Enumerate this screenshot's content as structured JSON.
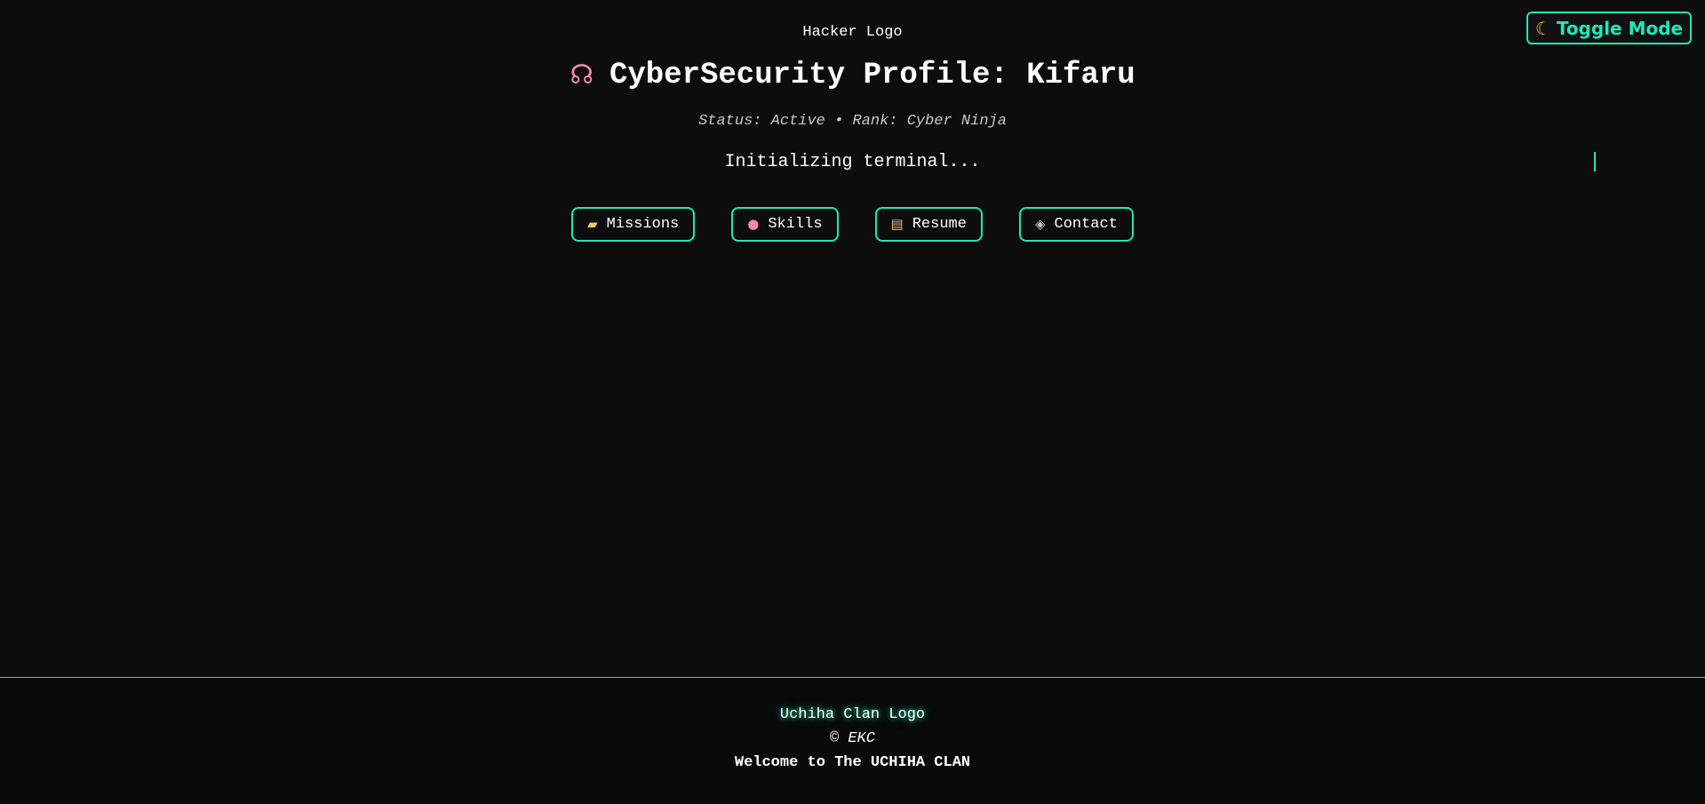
{
  "toggle": {
    "icon": "moon-icon",
    "label": "Toggle Mode"
  },
  "header": {
    "logo_alt": "Hacker Logo",
    "title_icon": "brain-icon",
    "title": "CyberSecurity Profile: Kifaru",
    "status": "Status: Active • Rank: Cyber Ninja",
    "terminal": "Initializing terminal..."
  },
  "nav": {
    "items": [
      {
        "icon": "folder-icon",
        "label": "Missions"
      },
      {
        "icon": "brain-icon",
        "label": "Skills"
      },
      {
        "icon": "scroll-icon",
        "label": "Resume"
      },
      {
        "icon": "satellite-icon",
        "label": "Contact"
      }
    ]
  },
  "footer": {
    "logo_alt": "Uchiha Clan Logo",
    "copyright": "© EKC",
    "welcome": "Welcome to The UCHIHA CLAN"
  },
  "colors": {
    "accent": "#1de9b6",
    "background": "#0d0d0d",
    "text": "#ffffff"
  }
}
